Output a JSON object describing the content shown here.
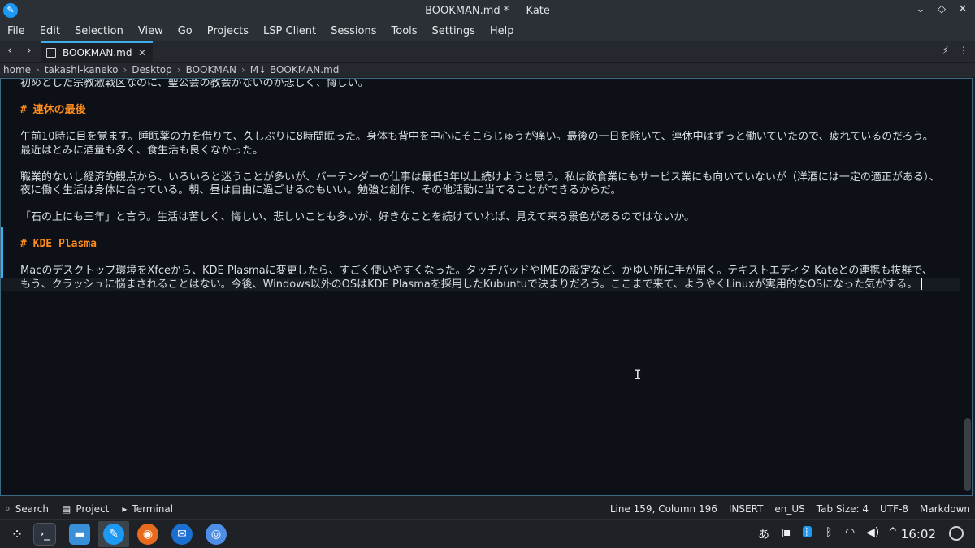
{
  "window": {
    "title": "BOOKMAN.md * — Kate",
    "controls": [
      "⌄",
      "◇",
      "✕"
    ]
  },
  "menu": [
    "File",
    "Edit",
    "Selection",
    "View",
    "Go",
    "Projects",
    "LSP Client",
    "Sessions",
    "Tools",
    "Settings",
    "Help"
  ],
  "tabs": {
    "back": "‹",
    "forward": "›",
    "active_label": "BOOKMAN.md",
    "close": "✕",
    "right_buttons": [
      "⚡",
      "⋮"
    ]
  },
  "breadcrumb": [
    "home",
    "takashi-kaneko",
    "Desktop",
    "BOOKMAN",
    "M↓ BOOKMAN.md"
  ],
  "editor": {
    "lines": [
      {
        "text": "初めとした宗教激戦区なのに、聖公会の教会がないのが悲しく、悔しい。",
        "kind": "jp"
      },
      {
        "text": "",
        "kind": "blank"
      },
      {
        "text": "# 連休の最後",
        "kind": "heading"
      },
      {
        "text": "",
        "kind": "blank"
      },
      {
        "text": "午前10時に目を覚ます。睡眠薬の力を借りて、久しぶりに8時間眠った。身体も背中を中心にそこらじゅうが痛い。最後の一日を除いて、連休中はずっと働いていたので、疲れているのだろう。",
        "kind": "jp"
      },
      {
        "text": "最近はとみに酒量も多く、食生活も良くなかった。",
        "kind": "jp"
      },
      {
        "text": "",
        "kind": "blank"
      },
      {
        "text": "職業的ないし経済的観点から、いろいろと迷うことが多いが、バーテンダーの仕事は最低3年以上続けようと思う。私は飲食業にもサービス業にも向いていないが（洋酒には一定の適正がある）、",
        "kind": "jp"
      },
      {
        "text": "夜に働く生活は身体に合っている。朝、昼は自由に過ごせるのもいい。勉強と創作、その他活動に当てることができるからだ。",
        "kind": "jp"
      },
      {
        "text": "",
        "kind": "blank"
      },
      {
        "text": "「石の上にも三年」と言う。生活は苦しく、悔しい、悲しいことも多いが、好きなことを続けていれば、見えて来る景色があるのではないか。",
        "kind": "jp"
      },
      {
        "text": "",
        "kind": "blank"
      },
      {
        "text": "# KDE Plasma",
        "kind": "heading"
      },
      {
        "text": "",
        "kind": "blank"
      },
      {
        "text": "Macのデスクトップ環境をXfceから、KDE Plasmaに変更したら、すごく使いやすくなった。タッチパッドやIMEの設定など、かゆい所に手が届く。テキストエディタ Kateとの連携も抜群で、",
        "kind": "jp"
      },
      {
        "text": "もう、クラッシュに悩まされることはない。今後、Windows以外のOSはKDE Plasmaを採用したKubuntuで決まりだろう。ここまで来て、ようやくLinuxが実用的なOSになった気がする。",
        "kind": "current"
      }
    ]
  },
  "statusbar": {
    "left": [
      {
        "icon": "search-icon",
        "glyph": "⌕",
        "label": "Search"
      },
      {
        "icon": "project-icon",
        "glyph": "▤",
        "label": "Project"
      },
      {
        "icon": "terminal-icon",
        "glyph": "▸",
        "label": "Terminal"
      }
    ],
    "position": "Line 159, Column 196",
    "mode": "INSERT",
    "dictionary": "en_US",
    "tab_size": "Tab Size: 4",
    "encoding": "UTF-8",
    "syntax": "Markdown"
  },
  "taskbar": {
    "ime": "あ",
    "clock": "16:02"
  },
  "colors": {
    "accent": "#3daee9",
    "heading": "#ff8c1a",
    "editor_bg": "#0d1117"
  }
}
